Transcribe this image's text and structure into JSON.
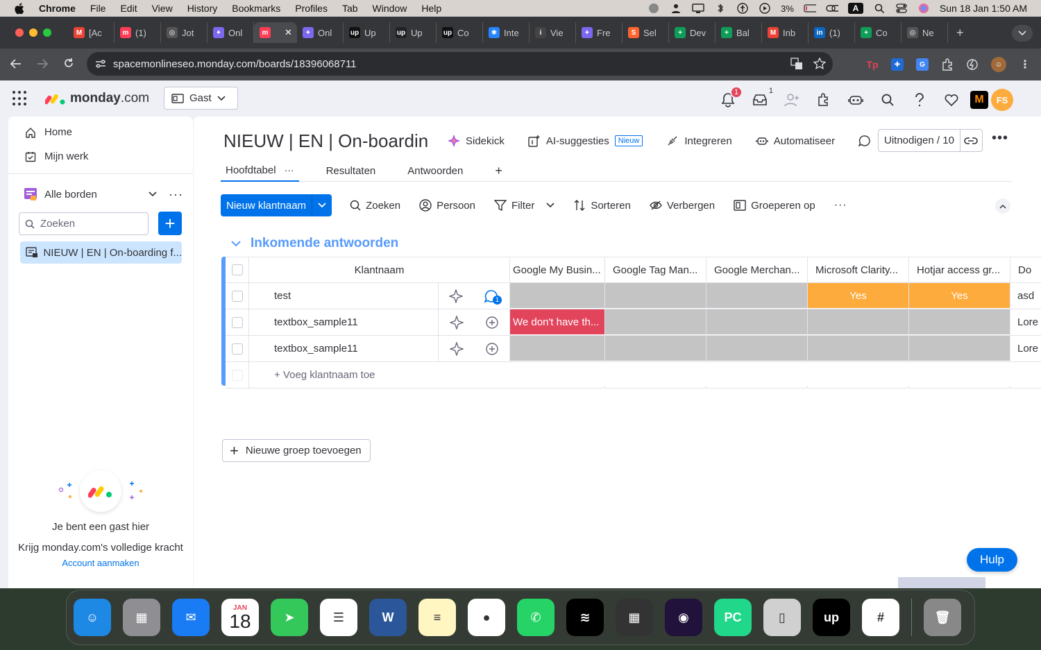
{
  "menubar": {
    "app": "Chrome",
    "items": [
      "File",
      "Edit",
      "View",
      "History",
      "Bookmarks",
      "Profiles",
      "Tab",
      "Window",
      "Help"
    ],
    "battery": "3%",
    "input_source": "A",
    "clock": "Sun 18 Jan  1:50 AM"
  },
  "tabs": [
    {
      "label": "[Ac",
      "icon": "gmail-icon",
      "color": "#ea4335",
      "glyph": "M"
    },
    {
      "label": "(1)",
      "icon": "monday-icon",
      "color": "#ff3d57",
      "glyph": "m"
    },
    {
      "label": "Jot",
      "icon": "openai-icon",
      "color": "#555555",
      "glyph": "◎"
    },
    {
      "label": "Onl",
      "icon": "clickup-icon",
      "color": "#7b68ee",
      "glyph": "✦"
    },
    {
      "label": "",
      "icon": "monday-icon",
      "color": "#ff3d57",
      "glyph": "m",
      "active": true
    },
    {
      "label": "Onl",
      "icon": "clickup-icon",
      "color": "#7b68ee",
      "glyph": "✦"
    },
    {
      "label": "Up",
      "icon": "upwork-icon",
      "color": "#111111",
      "glyph": "up"
    },
    {
      "label": "Up",
      "icon": "upwork-icon",
      "color": "#222222",
      "glyph": "up"
    },
    {
      "label": "Co",
      "icon": "upwork-icon",
      "color": "#111111",
      "glyph": "up"
    },
    {
      "label": "Inte",
      "icon": "jira-icon",
      "color": "#2684ff",
      "glyph": "✱"
    },
    {
      "label": "Vie",
      "icon": "site-icon",
      "color": "#444444",
      "glyph": "i"
    },
    {
      "label": "Fre",
      "icon": "clickup-icon",
      "color": "#7b68ee",
      "glyph": "✦"
    },
    {
      "label": "Sel",
      "icon": "semrush-icon",
      "color": "#ff642d",
      "glyph": "S"
    },
    {
      "label": "Dev",
      "icon": "sheets-icon",
      "color": "#0f9d58",
      "glyph": "+"
    },
    {
      "label": "Bal",
      "icon": "sheets-icon",
      "color": "#0f9d58",
      "glyph": "+"
    },
    {
      "label": "Inb",
      "icon": "gmail-icon",
      "color": "#ea4335",
      "glyph": "M"
    },
    {
      "label": "(1)",
      "icon": "linkedin-icon",
      "color": "#0a66c2",
      "glyph": "in"
    },
    {
      "label": "Co",
      "icon": "sheets-icon",
      "color": "#0f9d58",
      "glyph": "+"
    },
    {
      "label": "Ne",
      "icon": "openai-icon",
      "color": "#555555",
      "glyph": "◎"
    }
  ],
  "address": {
    "url": "spacemonlineseo.monday.com/boards/18396068711"
  },
  "topbar": {
    "logo_bold": "monday",
    "logo_rest": ".com",
    "workspace": "Gast",
    "notif_count": "1",
    "inbox_count": "1",
    "avatar": "FS"
  },
  "sidebar": {
    "home": "Home",
    "my_work": "Mijn werk",
    "boards": "Alle borden",
    "search_placeholder": "Zoeken",
    "board_item": "NIEUW | EN | On-boarding f...",
    "guest_title": "Je bent een gast hier",
    "guest_subtitle": "Krijg monday.com's volledige kracht",
    "guest_link": "Account aanmaken"
  },
  "board": {
    "title": "NIEUW | EN | On-boardin",
    "sidekick": "Sidekick",
    "ai": "AI-suggesties",
    "ai_badge": "Nieuw",
    "integrate": "Integreren",
    "automate": "Automatiseer",
    "invite": "Uitnodigen / 10",
    "views": [
      "Hoofdtabel",
      "Resultaten",
      "Antwoorden"
    ],
    "new_item": "Nieuw klantnaam",
    "toolbar": [
      "Zoeken",
      "Persoon",
      "Filter",
      "Sorteren",
      "Verbergen",
      "Groeperen op"
    ],
    "group_title": "Inkomende antwoorden",
    "columns": [
      "Klantnaam",
      "Google My Busin...",
      "Google Tag Man...",
      "Google Merchan...",
      "Microsoft Clarity...",
      "Hotjar access gr...",
      "Do"
    ],
    "rows": [
      {
        "name": "test",
        "cells": [
          "",
          "",
          "",
          "Yes",
          "Yes"
        ],
        "extra": "asd",
        "update_count": "1"
      },
      {
        "name": "textbox_sample11",
        "cells": [
          "We don't have th...",
          "",
          "",
          "",
          ""
        ],
        "extra": "Lore",
        "update_count": ""
      },
      {
        "name": "textbox_sample11",
        "cells": [
          "",
          "",
          "",
          "",
          ""
        ],
        "extra": "Lore",
        "update_count": ""
      }
    ],
    "add_item": "+ Voeg klantnaam toe",
    "add_group": "Nieuwe groep toevoegen",
    "help": "Hulp"
  },
  "status_colors": {
    "red": "#e2445c",
    "orange": "#fdab3d",
    "empty": "#c4c4c4"
  },
  "summary": [
    {
      "color": "#e2445c",
      "fraction": 0.3
    },
    {
      "color": "#fdab3d",
      "fraction": 0
    },
    {
      "color": "#fdab3d",
      "fraction": 0
    },
    {
      "color": "#fdab3d",
      "fraction": 0.33
    },
    {
      "color": "#fdab3d",
      "fraction": 0.33
    }
  ],
  "dock": [
    {
      "name": "finder",
      "color": "#1e88e5",
      "glyph": "☺"
    },
    {
      "name": "launchpad",
      "color": "#8e8e93",
      "glyph": "▦"
    },
    {
      "name": "mail",
      "color": "#1a7cf5",
      "glyph": "✉"
    },
    {
      "name": "calendar",
      "color": "#ffffff",
      "glyph": "18",
      "month": "JAN"
    },
    {
      "name": "maps",
      "color": "#34c759",
      "glyph": "➤"
    },
    {
      "name": "reminders",
      "color": "#ffffff",
      "glyph": "☰"
    },
    {
      "name": "word",
      "color": "#2b579a",
      "glyph": "W"
    },
    {
      "name": "notes",
      "color": "#fff6c2",
      "glyph": "≡"
    },
    {
      "name": "chrome",
      "color": "#ffffff",
      "glyph": "●"
    },
    {
      "name": "whatsapp",
      "color": "#25d366",
      "glyph": "✆"
    },
    {
      "name": "spotify",
      "color": "#000000",
      "glyph": "≋"
    },
    {
      "name": "calculator",
      "color": "#333333",
      "glyph": "▦"
    },
    {
      "name": "firefox",
      "color": "#20123a",
      "glyph": "◉"
    },
    {
      "name": "pycharm",
      "color": "#21d789",
      "glyph": "PC"
    },
    {
      "name": "iphone-mirroring",
      "color": "#d0d0d0",
      "glyph": "▯"
    },
    {
      "name": "upwork",
      "color": "#000000",
      "glyph": "up"
    },
    {
      "name": "slack",
      "color": "#ffffff",
      "glyph": "#"
    },
    {
      "name": "trash",
      "color": "#888888",
      "glyph": "🗑"
    }
  ]
}
